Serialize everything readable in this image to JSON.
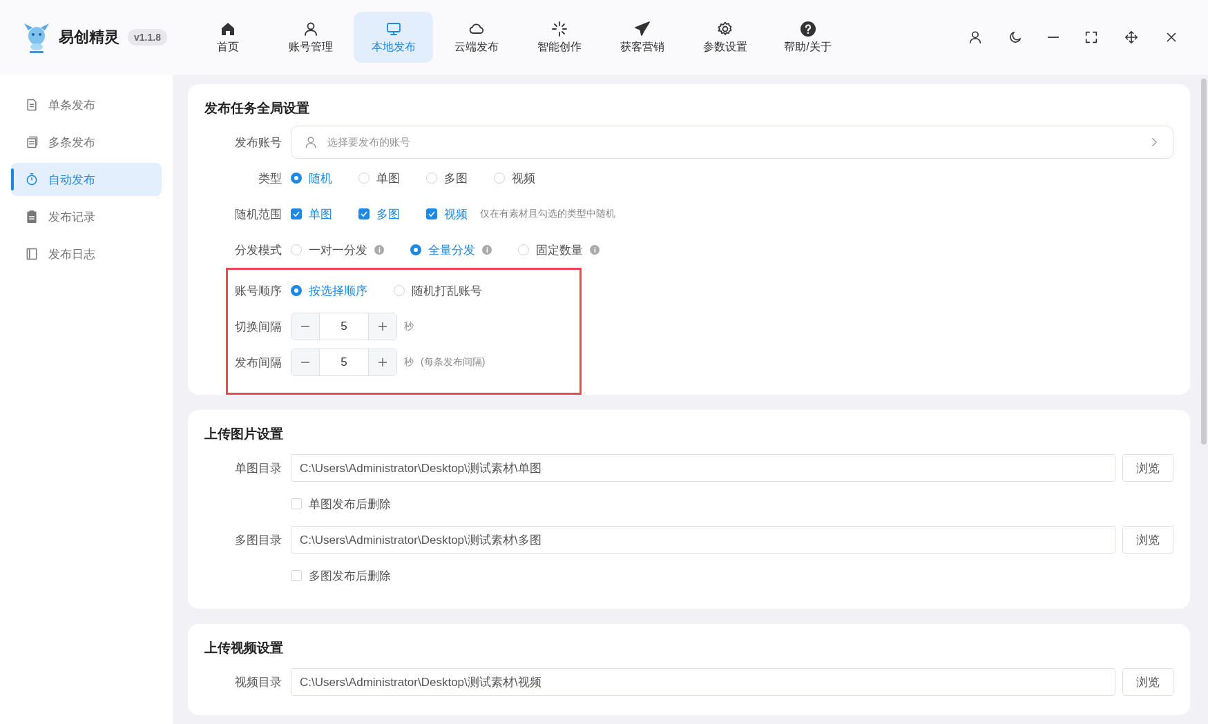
{
  "app": {
    "name": "易创精灵",
    "version": "v1.1.8"
  },
  "nav": [
    {
      "label": "首页",
      "selected": false
    },
    {
      "label": "账号管理",
      "selected": false
    },
    {
      "label": "本地发布",
      "selected": true
    },
    {
      "label": "云端发布",
      "selected": false
    },
    {
      "label": "智能创作",
      "selected": false
    },
    {
      "label": "获客营销",
      "selected": false
    },
    {
      "label": "参数设置",
      "selected": false
    },
    {
      "label": "帮助/关于",
      "selected": false
    }
  ],
  "sidebar": [
    {
      "label": "单条发布",
      "selected": false
    },
    {
      "label": "多条发布",
      "selected": false
    },
    {
      "label": "自动发布",
      "selected": true
    },
    {
      "label": "发布记录",
      "selected": false
    },
    {
      "label": "发布日志",
      "selected": false
    }
  ],
  "sections": [
    {
      "title": "发布任务全局设置",
      "rows": [
        {
          "kind": "select",
          "label": "发布账号",
          "placeholder": "选择要发布的账号",
          "highlighted": false
        },
        {
          "kind": "radio",
          "label": "类型",
          "highlighted": false,
          "options": [
            {
              "label": "随机",
              "selected": true
            },
            {
              "label": "单图",
              "selected": false
            },
            {
              "label": "多图",
              "selected": false
            },
            {
              "label": "视频",
              "selected": false
            }
          ]
        },
        {
          "kind": "checkbox",
          "label": "随机范围",
          "highlighted": false,
          "hint": "仅在有素材且勾选的类型中随机",
          "options": [
            {
              "label": "单图",
              "checked": true
            },
            {
              "label": "多图",
              "checked": true
            },
            {
              "label": "视频",
              "checked": true
            }
          ]
        },
        {
          "kind": "radio",
          "label": "分发模式",
          "highlighted": false,
          "options": [
            {
              "label": "一对一分发",
              "selected": false,
              "info": true
            },
            {
              "label": "全量分发",
              "selected": true,
              "info": true
            },
            {
              "label": "固定数量",
              "selected": false,
              "info": true
            }
          ]
        },
        {
          "kind": "radio",
          "label": "账号顺序",
          "highlighted": true,
          "options": [
            {
              "label": "按选择顺序",
              "selected": true
            },
            {
              "label": "随机打乱账号",
              "selected": false
            }
          ]
        },
        {
          "kind": "stepper",
          "label": "切换间隔",
          "highlighted": true,
          "value": "5",
          "unit": "秒"
        },
        {
          "kind": "stepper",
          "label": "发布间隔",
          "highlighted": true,
          "value": "5",
          "unit": "秒",
          "note": "(每条发布间隔)"
        }
      ]
    },
    {
      "title": "上传图片设置",
      "rows": [
        {
          "kind": "path",
          "label": "单图目录",
          "highlighted": false,
          "value": "C:\\Users\\Administrator\\Desktop\\测试素材\\单图",
          "button": "浏览"
        },
        {
          "kind": "check",
          "label": "单图发布后删除",
          "highlighted": false,
          "checked": false
        },
        {
          "kind": "path",
          "label": "多图目录",
          "highlighted": false,
          "value": "C:\\Users\\Administrator\\Desktop\\测试素材\\多图",
          "button": "浏览"
        },
        {
          "kind": "check",
          "label": "多图发布后删除",
          "highlighted": false,
          "checked": false
        }
      ]
    },
    {
      "title": "上传视频设置",
      "rows": [
        {
          "kind": "path",
          "label": "视频目录",
          "highlighted": false,
          "value": "C:\\Users\\Administrator\\Desktop\\测试素材\\视频",
          "button": "浏览"
        }
      ]
    }
  ]
}
